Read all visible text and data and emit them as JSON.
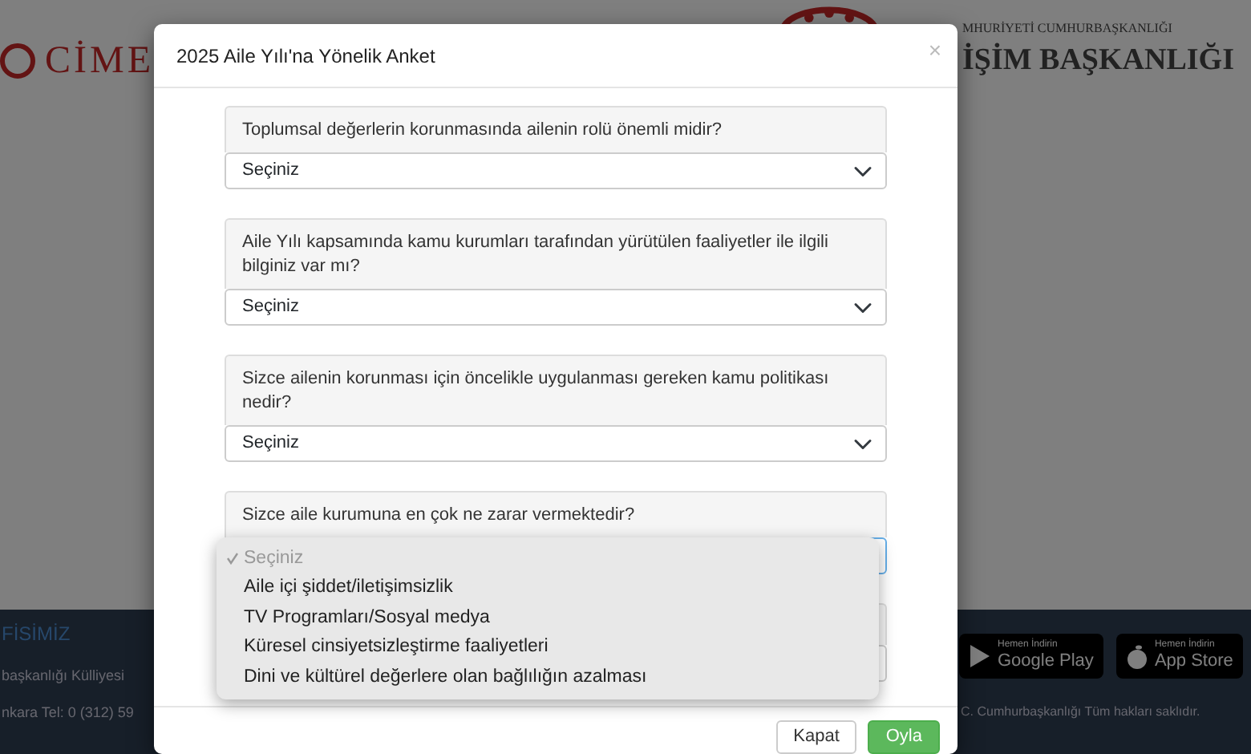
{
  "background_page": {
    "left_logo": "CİME",
    "right_logo_top": "MHURİYETİ CUMHURBAŞKANLIĞI",
    "right_logo_main": "İŞİM BAŞKANLIĞI",
    "footer": {
      "heading": "FİSİMİZ",
      "address_lines": [
        "başkanlığı Külliyesi",
        "nkara Tel: 0 (312) 59"
      ],
      "store_badges": [
        {
          "kind": "google",
          "caption": "Hemen İndirin",
          "store": "Google Play"
        },
        {
          "kind": "apple",
          "caption": "Hemen İndirin",
          "store": "App Store"
        }
      ],
      "copyright": "C. Cumhurbaşkanlığı Tüm hakları saklıdır."
    }
  },
  "modal": {
    "title": "2025 Aile Yılı'na Yönelik Anket",
    "close": "×",
    "questions": [
      {
        "question": "Toplumsal değerlerin korunmasında ailenin rolü önemli midir?",
        "value": "Seçiniz",
        "open": false
      },
      {
        "question": "Aile Yılı kapsamında kamu kurumları tarafından yürütülen faaliyetler ile ilgili bilginiz var mı?",
        "value": "Seçiniz",
        "open": false
      },
      {
        "question": "Sizce ailenin korunması için öncelikle uygulanması gereken kamu politikası nedir?",
        "value": "Seçiniz",
        "open": false
      },
      {
        "question": "Sizce aile kurumuna en çok ne zarar vermektedir?",
        "open": true,
        "options": [
          {
            "label": "Seçiniz",
            "selected": true,
            "disabled": true
          },
          {
            "label": "Aile içi şiddet/iletişimsizlik",
            "selected": false,
            "disabled": false
          },
          {
            "label": "TV Programları/Sosyal medya",
            "selected": false,
            "disabled": false
          },
          {
            "label": "Küresel cinsiyetsizleştirme faaliyetleri",
            "selected": false,
            "disabled": false
          },
          {
            "label": "Dini ve kültürel değerlere olan bağlılığın azalması",
            "selected": false,
            "disabled": false
          }
        ]
      }
    ],
    "buttons": [
      {
        "label": "Kapat",
        "kind": "default"
      },
      {
        "label": "Oyla",
        "kind": "success"
      }
    ]
  }
}
